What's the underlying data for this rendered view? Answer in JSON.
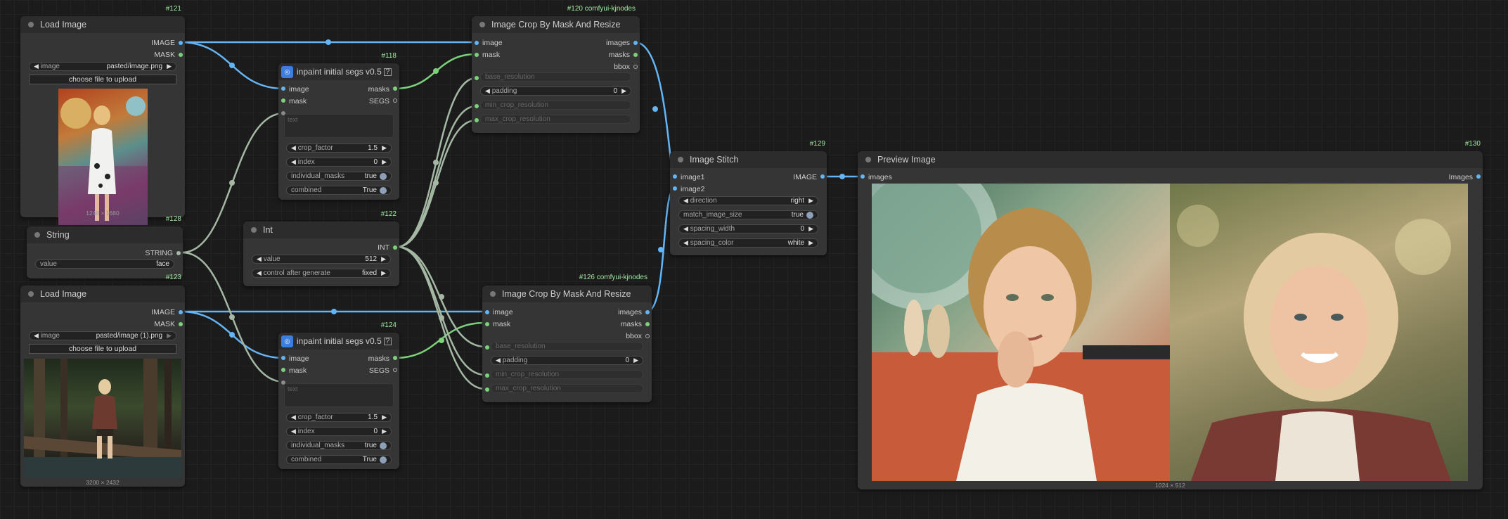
{
  "node_ids": {
    "n121": "#121",
    "n118": "#118",
    "n120": "#120 comfyui-kjnodes",
    "n128": "#128",
    "n122": "#122",
    "n123": "#123",
    "n124": "#124",
    "n126": "#126 comfyui-kjnodes",
    "n129": "#129",
    "n130": "#130"
  },
  "load_image_1": {
    "title": "Load Image",
    "out_image": "IMAGE",
    "out_mask": "MASK",
    "image_label": "image",
    "image_value": "pasted/image.png",
    "upload_label": "choose file to upload",
    "caption": "1248 × 1680"
  },
  "load_image_2": {
    "title": "Load Image",
    "out_image": "IMAGE",
    "out_mask": "MASK",
    "image_label": "image",
    "image_value": "pasted/image (1).png",
    "upload_label": "choose file to upload",
    "caption": "3200 × 2432"
  },
  "segs_1": {
    "title": "inpaint initial segs v0.5",
    "in_image": "image",
    "in_mask": "mask",
    "out_masks": "masks",
    "out_segs": "SEGS",
    "text_placeholder": "text",
    "crop_factor_label": "crop_factor",
    "crop_factor_value": "1.5",
    "index_label": "index",
    "index_value": "0",
    "individual_masks_label": "individual_masks",
    "individual_masks_value": "true",
    "combined_label": "combined",
    "combined_value": "True"
  },
  "segs_2": {
    "title": "inpaint initial segs v0.5",
    "in_image": "image",
    "in_mask": "mask",
    "out_masks": "masks",
    "out_segs": "SEGS",
    "text_placeholder": "text",
    "crop_factor_label": "crop_factor",
    "crop_factor_value": "1.5",
    "index_label": "index",
    "index_value": "0",
    "individual_masks_label": "individual_masks",
    "individual_masks_value": "true",
    "combined_label": "combined",
    "combined_value": "True"
  },
  "string_node": {
    "title": "String",
    "out": "STRING",
    "value_label": "value",
    "value": "face"
  },
  "int_node": {
    "title": "Int",
    "out": "INT",
    "value_label": "value",
    "value": "512",
    "control_label": "control after generate",
    "control_value": "fixed"
  },
  "crop_1": {
    "title": "Image Crop By Mask And Resize",
    "in_image": "image",
    "in_mask": "mask",
    "out_images": "images",
    "out_masks": "masks",
    "out_bbox": "bbox",
    "base_resolution": "base_resolution",
    "padding_label": "padding",
    "padding_value": "0",
    "min_crop": "min_crop_resolution",
    "max_crop": "max_crop_resolution"
  },
  "crop_2": {
    "title": "Image Crop By Mask And Resize",
    "in_image": "image",
    "in_mask": "mask",
    "out_images": "images",
    "out_masks": "masks",
    "out_bbox": "bbox",
    "base_resolution": "base_resolution",
    "padding_label": "padding",
    "padding_value": "0",
    "min_crop": "min_crop_resolution",
    "max_crop": "max_crop_resolution"
  },
  "stitch": {
    "title": "Image Stitch",
    "in_image1": "image1",
    "in_image2": "image2",
    "out": "IMAGE",
    "direction_label": "direction",
    "direction_value": "right",
    "match_label": "match_image_size",
    "match_value": "true",
    "spacing_width_label": "spacing_width",
    "spacing_width_value": "0",
    "spacing_color_label": "spacing_color",
    "spacing_color_value": "white"
  },
  "preview": {
    "title": "Preview Image",
    "in_images": "images",
    "out_images": "Images",
    "caption": "1024 × 512"
  },
  "colors": {
    "image_wire": "#64b5f6",
    "mask_wire": "#7bd27b",
    "other_wire": "#a4b8a4",
    "node_id": "#9fe8a0"
  }
}
